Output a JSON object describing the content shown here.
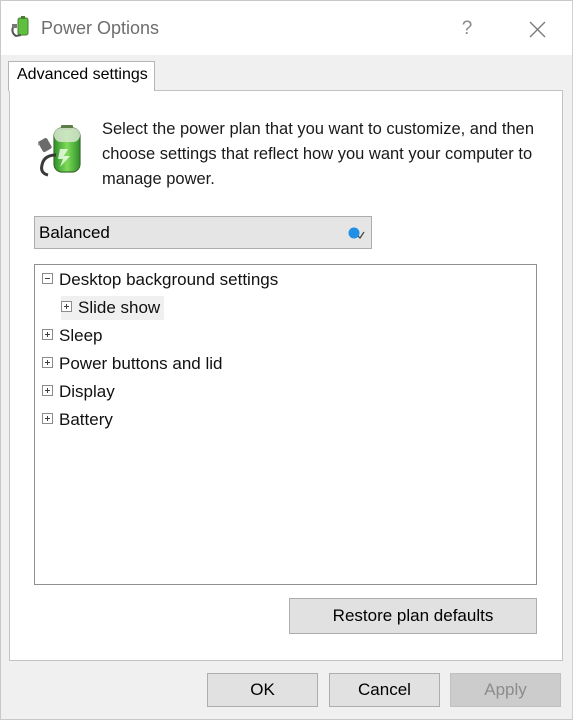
{
  "window": {
    "title": "Power Options",
    "help_label": "?",
    "close_icon": "close-icon",
    "app_icon": "power-plan-icon"
  },
  "tabs": [
    {
      "label": "Advanced settings",
      "active": true
    }
  ],
  "description": "Select the power plan that you want to customize, and then choose settings that reflect how you want your computer to manage power.",
  "plan_select": {
    "value": "Balanced",
    "marker_color": "#1e90e6"
  },
  "tree": {
    "items": [
      {
        "label": "Desktop background settings",
        "level": 0,
        "expanded": true
      },
      {
        "label": "Slide show",
        "level": 1,
        "expanded": false,
        "selected": true
      },
      {
        "label": "Sleep",
        "level": 0,
        "expanded": false
      },
      {
        "label": "Power buttons and lid",
        "level": 0,
        "expanded": false
      },
      {
        "label": "Display",
        "level": 0,
        "expanded": false
      },
      {
        "label": "Battery",
        "level": 0,
        "expanded": false
      }
    ]
  },
  "buttons": {
    "restore": "Restore plan defaults",
    "ok": "OK",
    "cancel": "Cancel",
    "apply": "Apply",
    "apply_enabled": false
  }
}
